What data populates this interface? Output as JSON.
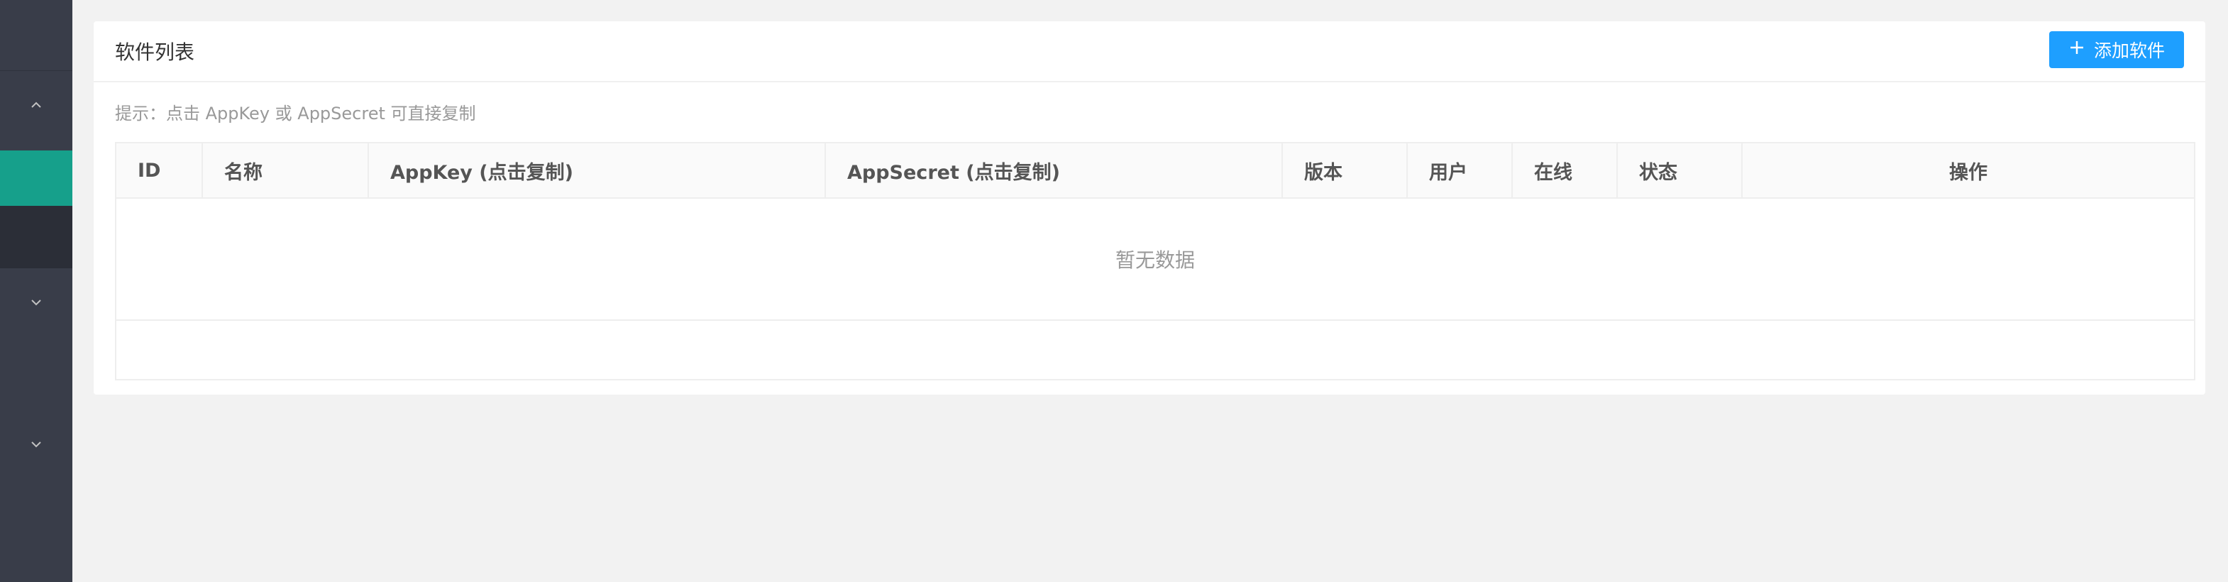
{
  "sidebar": {
    "groups": [
      {
        "icon": "chevron-up-icon",
        "state": "expanded"
      },
      {
        "icon": "chevron-down-icon",
        "state": "collapsed"
      },
      {
        "icon": "chevron-down-icon",
        "state": "collapsed"
      }
    ],
    "active_color": "#16a08b",
    "background": "#393d49"
  },
  "card": {
    "title": "软件列表",
    "add_button": {
      "label": "添加软件",
      "icon": "plus-icon",
      "color": "#1e9fff"
    },
    "tip": "提示：点击 AppKey 或 AppSecret 可直接复制"
  },
  "table": {
    "columns": [
      "ID",
      "名称",
      "AppKey (点击复制)",
      "AppSecret (点击复制)",
      "版本",
      "用户",
      "在线",
      "状态",
      "操作"
    ],
    "empty_text": "暂无数据"
  }
}
